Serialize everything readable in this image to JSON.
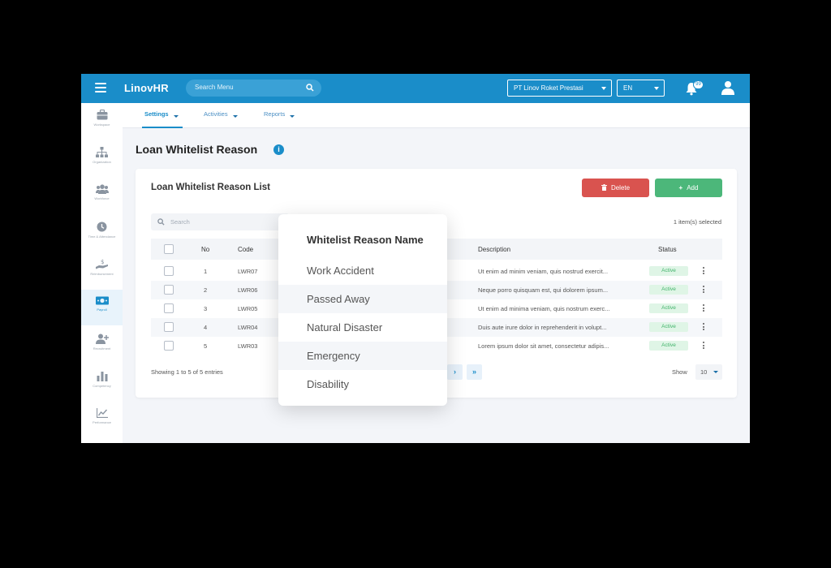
{
  "app": {
    "logo_prefix": "Linov",
    "logo_suffix": "HR"
  },
  "topbar": {
    "search_placeholder": "Search Menu",
    "company": "PT Linov Roket Prestasi",
    "language": "EN",
    "notification_count": "99"
  },
  "sidebar": {
    "items": [
      {
        "label": "Workspace",
        "icon": "briefcase-icon"
      },
      {
        "label": "Organization",
        "icon": "org-chart-icon"
      },
      {
        "label": "Workforce",
        "icon": "people-icon"
      },
      {
        "label": "Time & Attendance",
        "icon": "clock-icon"
      },
      {
        "label": "Reimbursement",
        "icon": "hand-money-icon"
      },
      {
        "label": "Payroll",
        "icon": "banknote-icon"
      },
      {
        "label": "Recruitment",
        "icon": "add-user-icon"
      },
      {
        "label": "Competency",
        "icon": "bar-chart-icon"
      },
      {
        "label": "Performance",
        "icon": "line-chart-icon"
      }
    ]
  },
  "subnav": {
    "tabs": [
      "Settings",
      "Activities",
      "Reports"
    ]
  },
  "page": {
    "title": "Loan Whitelist Reason"
  },
  "card": {
    "title": "Loan Whitelist Reason List",
    "delete_label": "Delete",
    "add_label": "Add",
    "search_placeholder": "Search",
    "selected": "1 item(s) selected"
  },
  "table": {
    "headers": {
      "no": "No",
      "code": "Code",
      "description": "Description",
      "status": "Status"
    },
    "rows": [
      {
        "no": "1",
        "code": "LWR07",
        "description": "Ut enim ad minim veniam, quis nostrud exercit...",
        "status": "Active"
      },
      {
        "no": "2",
        "code": "LWR06",
        "description": "Neque porro quisquam est, qui dolorem ipsum...",
        "status": "Active"
      },
      {
        "no": "3",
        "code": "LWR05",
        "description": "Ut enim ad minima veniam, quis nostrum exerc...",
        "status": "Active"
      },
      {
        "no": "4",
        "code": "LWR04",
        "description": "Duis aute irure dolor in reprehenderit in volupt...",
        "status": "Active"
      },
      {
        "no": "5",
        "code": "LWR03",
        "description": "Lorem ipsum dolor sit amet, consectetur adipis...",
        "status": "Active"
      }
    ],
    "footer_info": "Showing 1 to 5 of 5 entries",
    "show_label": "Show",
    "page_size": "10"
  },
  "popup": {
    "header": "Whitelist Reason Name",
    "items": [
      "Work Accident",
      "Passed Away",
      "Natural Disaster",
      "Emergency",
      "Disability"
    ]
  },
  "colors": {
    "primary": "#1a8dc9",
    "delete": "#d9534f",
    "add": "#4cb77a",
    "active_status": "#41b36a"
  }
}
